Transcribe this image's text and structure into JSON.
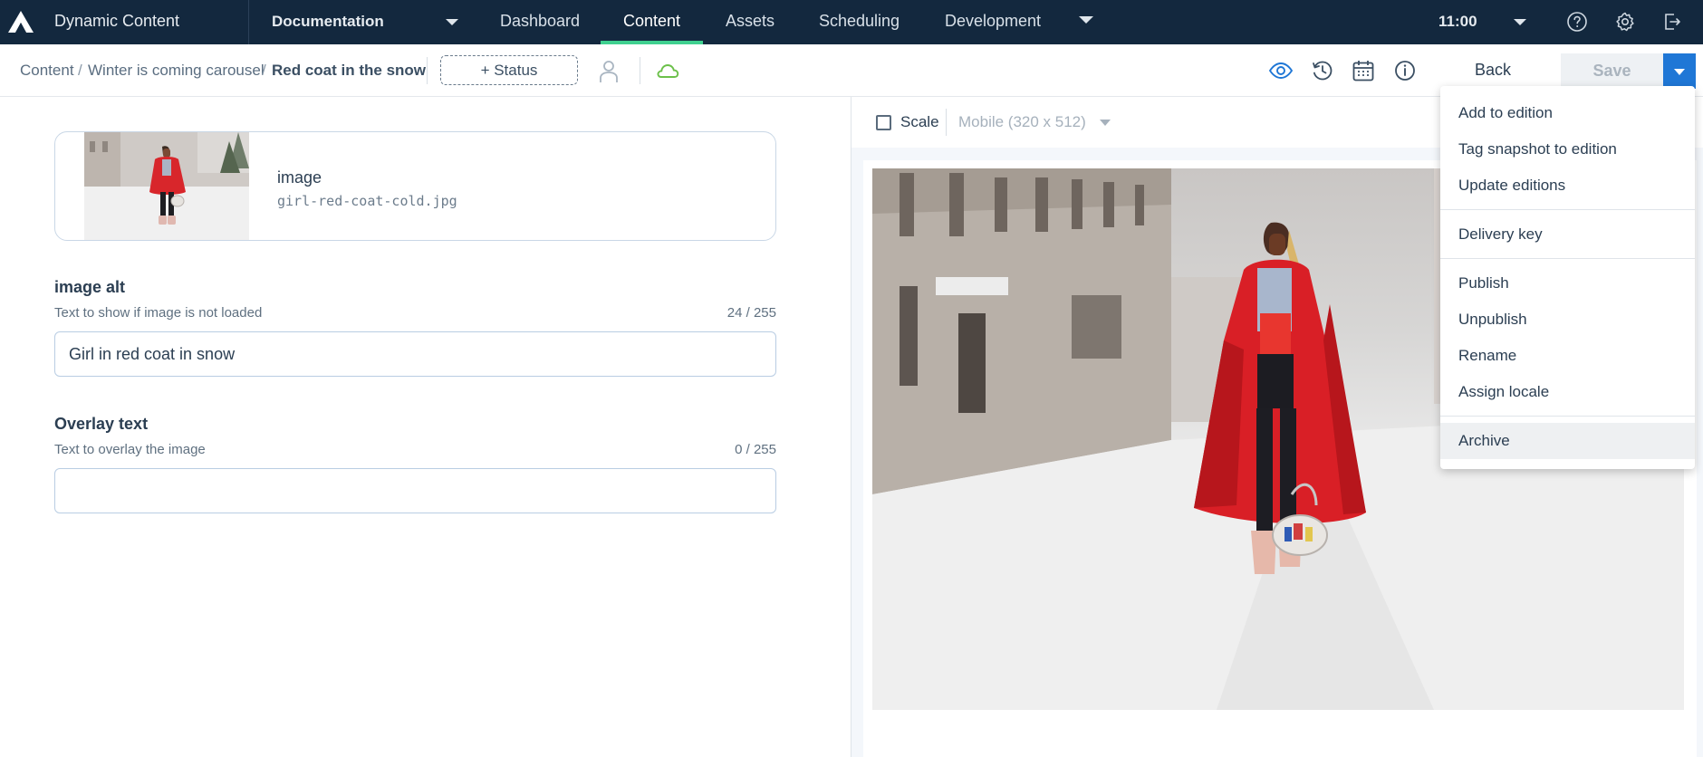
{
  "topbar": {
    "app_name": "Dynamic Content",
    "hub": "Documentation",
    "nav": [
      "Dashboard",
      "Content",
      "Assets",
      "Scheduling",
      "Development"
    ],
    "active_nav": "Content",
    "time": "11:00",
    "icons": [
      "help-icon",
      "settings-icon",
      "logout-icon"
    ]
  },
  "breadcrumb": {
    "items": [
      "Content",
      "Winter is coming carousel",
      "Red coat in the snow"
    ],
    "separator": "/"
  },
  "toolbar": {
    "status_button": "+ Status",
    "back_label": "Back",
    "save_label": "Save",
    "icons": [
      "user-icon",
      "cloud-icon",
      "preview-eye-icon",
      "history-icon",
      "calendar-icon",
      "info-icon"
    ]
  },
  "form": {
    "image": {
      "label": "image",
      "filename": "girl-red-coat-cold.jpg"
    },
    "image_alt": {
      "title": "image alt",
      "help": "Text to show if image is not loaded",
      "count": "24 / 255",
      "value": "Girl in red coat in snow"
    },
    "overlay_text": {
      "title": "Overlay text",
      "help": "Text to overlay the image",
      "count": "0 / 255",
      "value": ""
    }
  },
  "preview": {
    "scale_label": "Scale",
    "scale_checked": false,
    "device": "Mobile (320 x 512)"
  },
  "save_menu": {
    "groups": [
      [
        "Add to edition",
        "Tag snapshot to edition",
        "Update editions"
      ],
      [
        "Delivery key"
      ],
      [
        "Publish",
        "Unpublish",
        "Rename",
        "Assign locale"
      ],
      [
        "Archive"
      ]
    ],
    "highlighted": "Archive"
  },
  "colors": {
    "topbar_bg": "#13283e",
    "active_tab_underline": "#3fd08f",
    "primary_blue": "#1f77d6",
    "cloud_green": "#6cc04a"
  }
}
